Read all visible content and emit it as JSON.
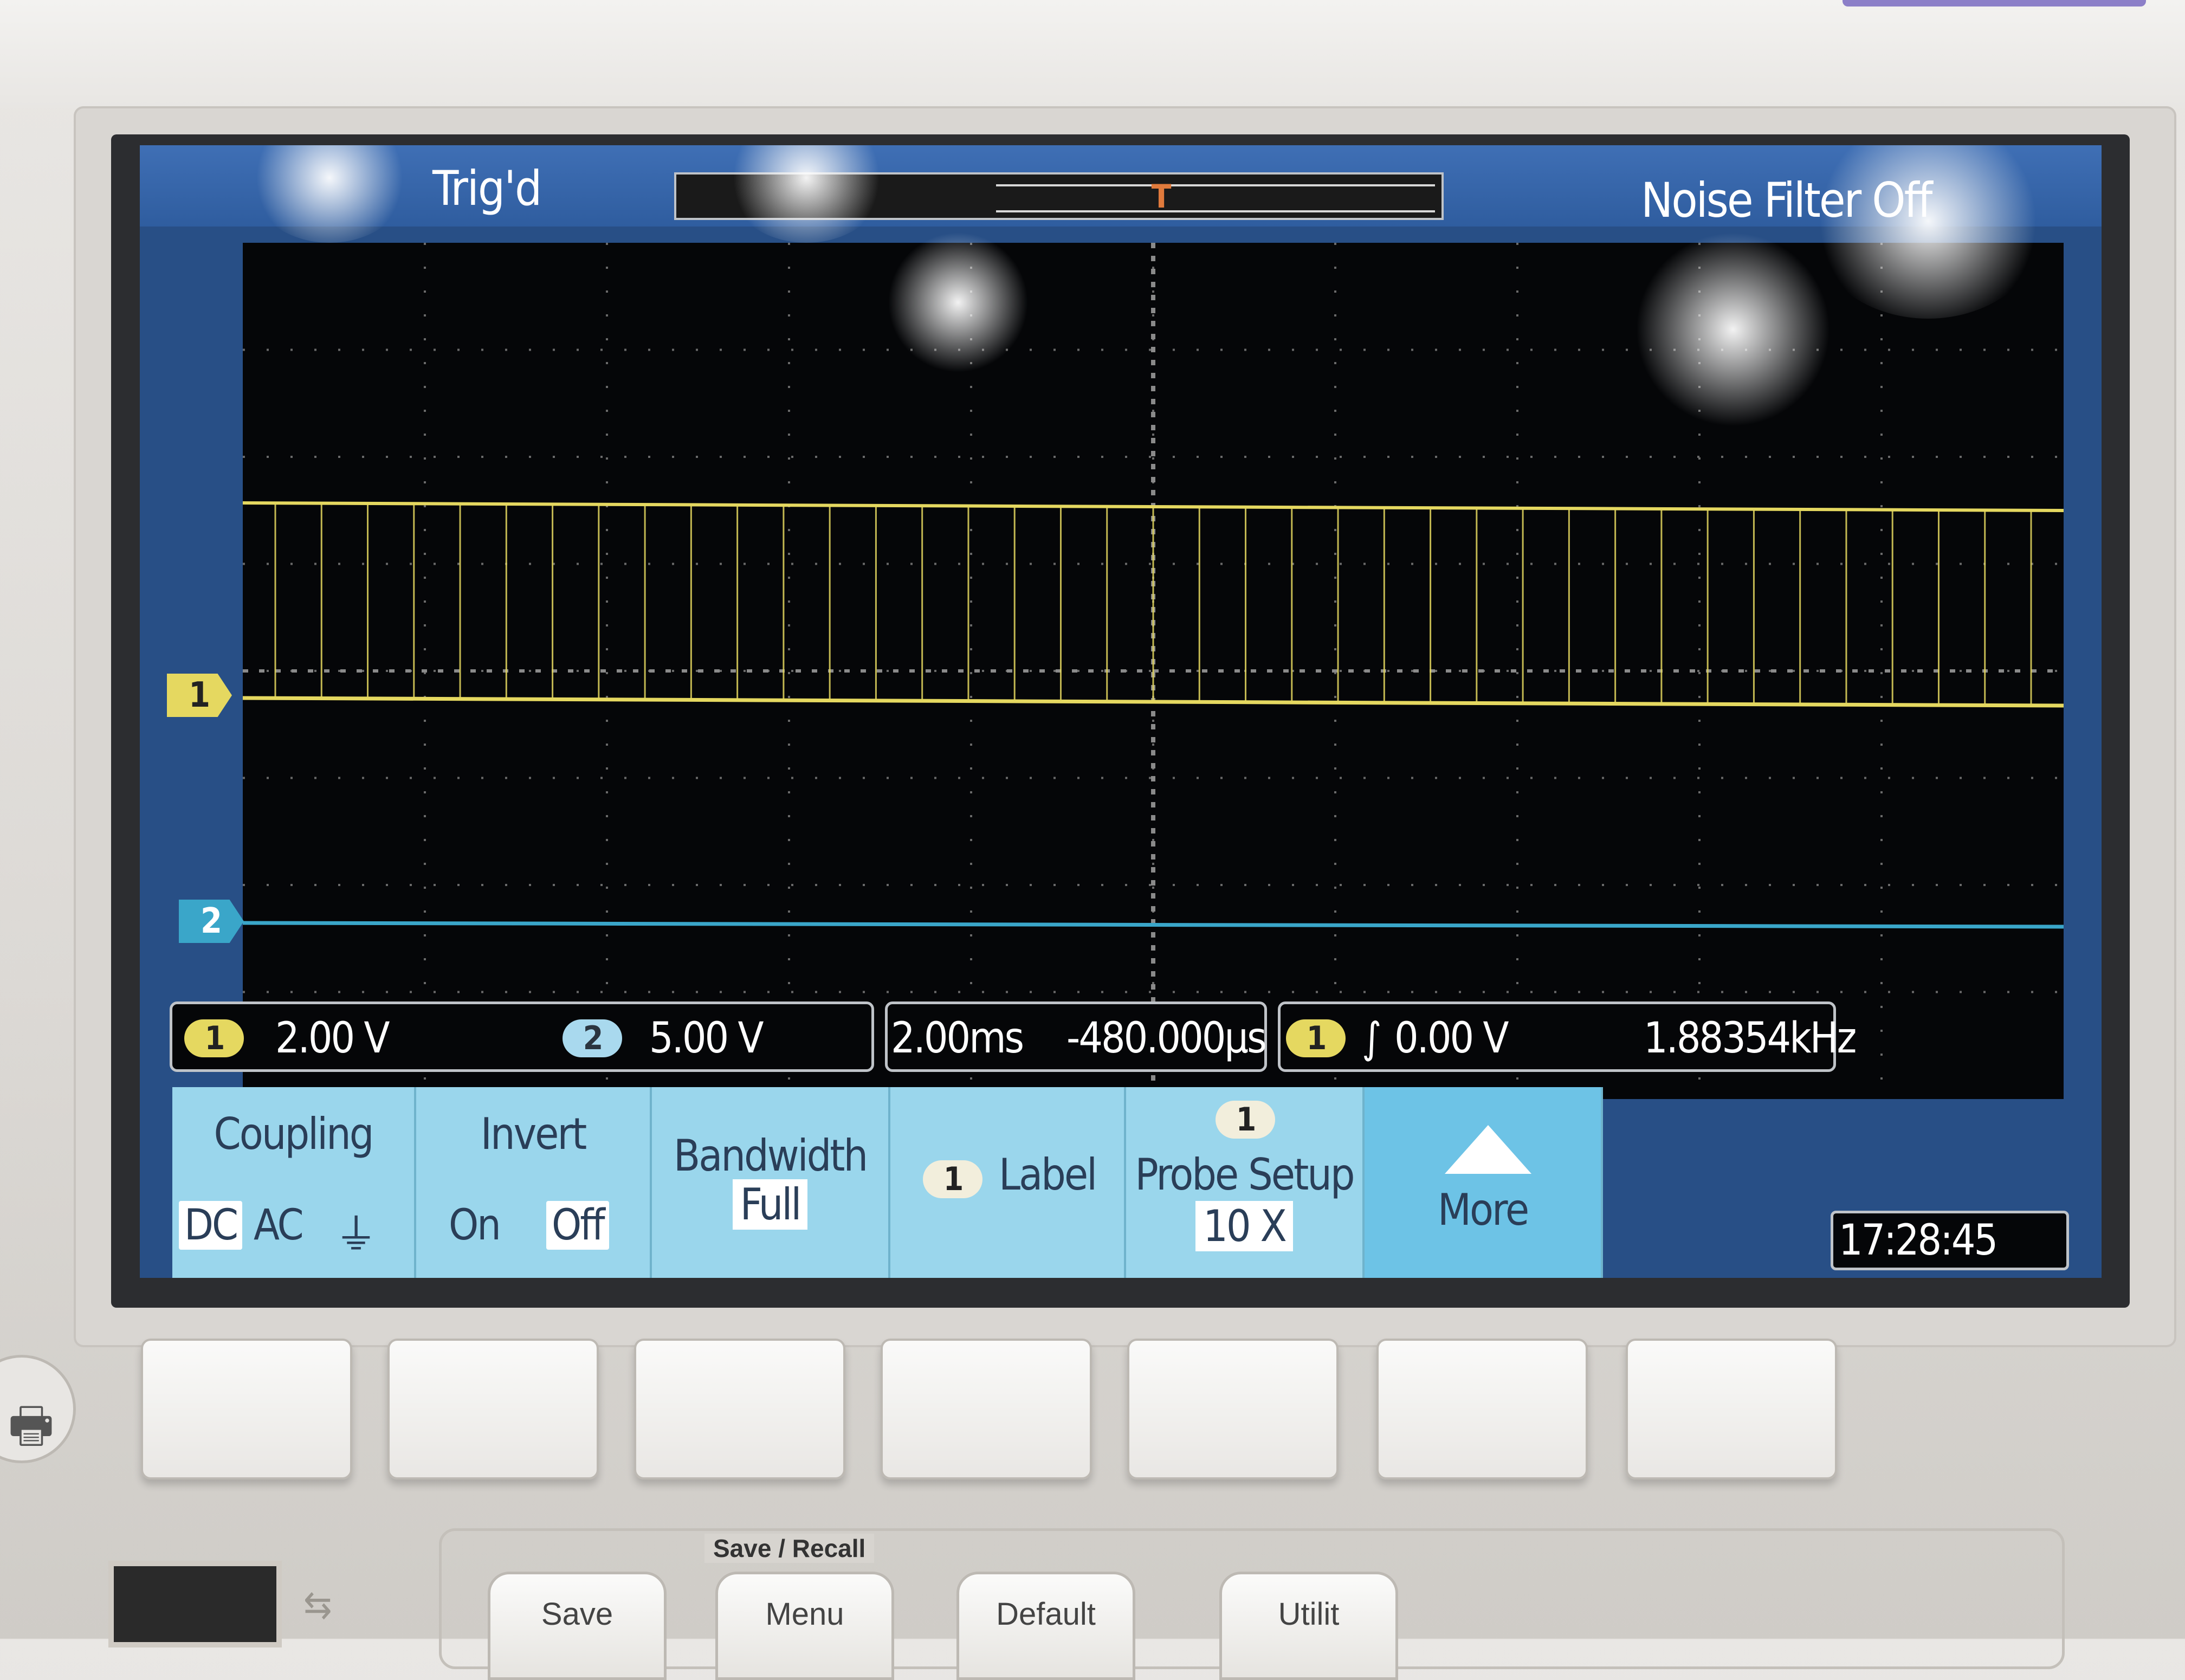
{
  "status_bar": {
    "trigger_state": "Trig'd",
    "noise_filter": "Noise Filter Off",
    "trigger_marker": "T"
  },
  "channel_markers": {
    "ch1": "1",
    "ch2": "2"
  },
  "channel_info": {
    "ch1_chip": "1",
    "ch1_scale": "2.00 V",
    "ch2_chip": "2",
    "ch2_scale": "5.00 V"
  },
  "timebase": {
    "time_per_div": "2.00ms",
    "delay": "-480.000µs"
  },
  "trigger": {
    "source_chip": "1",
    "level": "0.00 V",
    "frequency": "1.88354kHz"
  },
  "softkeys": {
    "coupling": {
      "title": "Coupling",
      "options": [
        "DC",
        "AC",
        "⏚"
      ],
      "selected": "DC"
    },
    "invert": {
      "title": "Invert",
      "options": [
        "On",
        "Off"
      ],
      "selected": "Off"
    },
    "bandwidth": {
      "title": "Bandwidth",
      "value": "Full"
    },
    "label": {
      "chip": "1",
      "title": "Label"
    },
    "probe_setup": {
      "chip": "1",
      "title": "Probe Setup",
      "value": "10 X"
    },
    "more": {
      "title": "More"
    }
  },
  "clock": "17:28:45",
  "front_panel": {
    "section_title": "Save / Recall",
    "buttons": [
      "Save",
      "Menu",
      "Default",
      "Utilit"
    ]
  },
  "colors": {
    "ch1": "#e5d860",
    "ch2": "#3aa6c9",
    "softkey_bg": "#9ad6ec",
    "screen_frame": "#284f86"
  }
}
